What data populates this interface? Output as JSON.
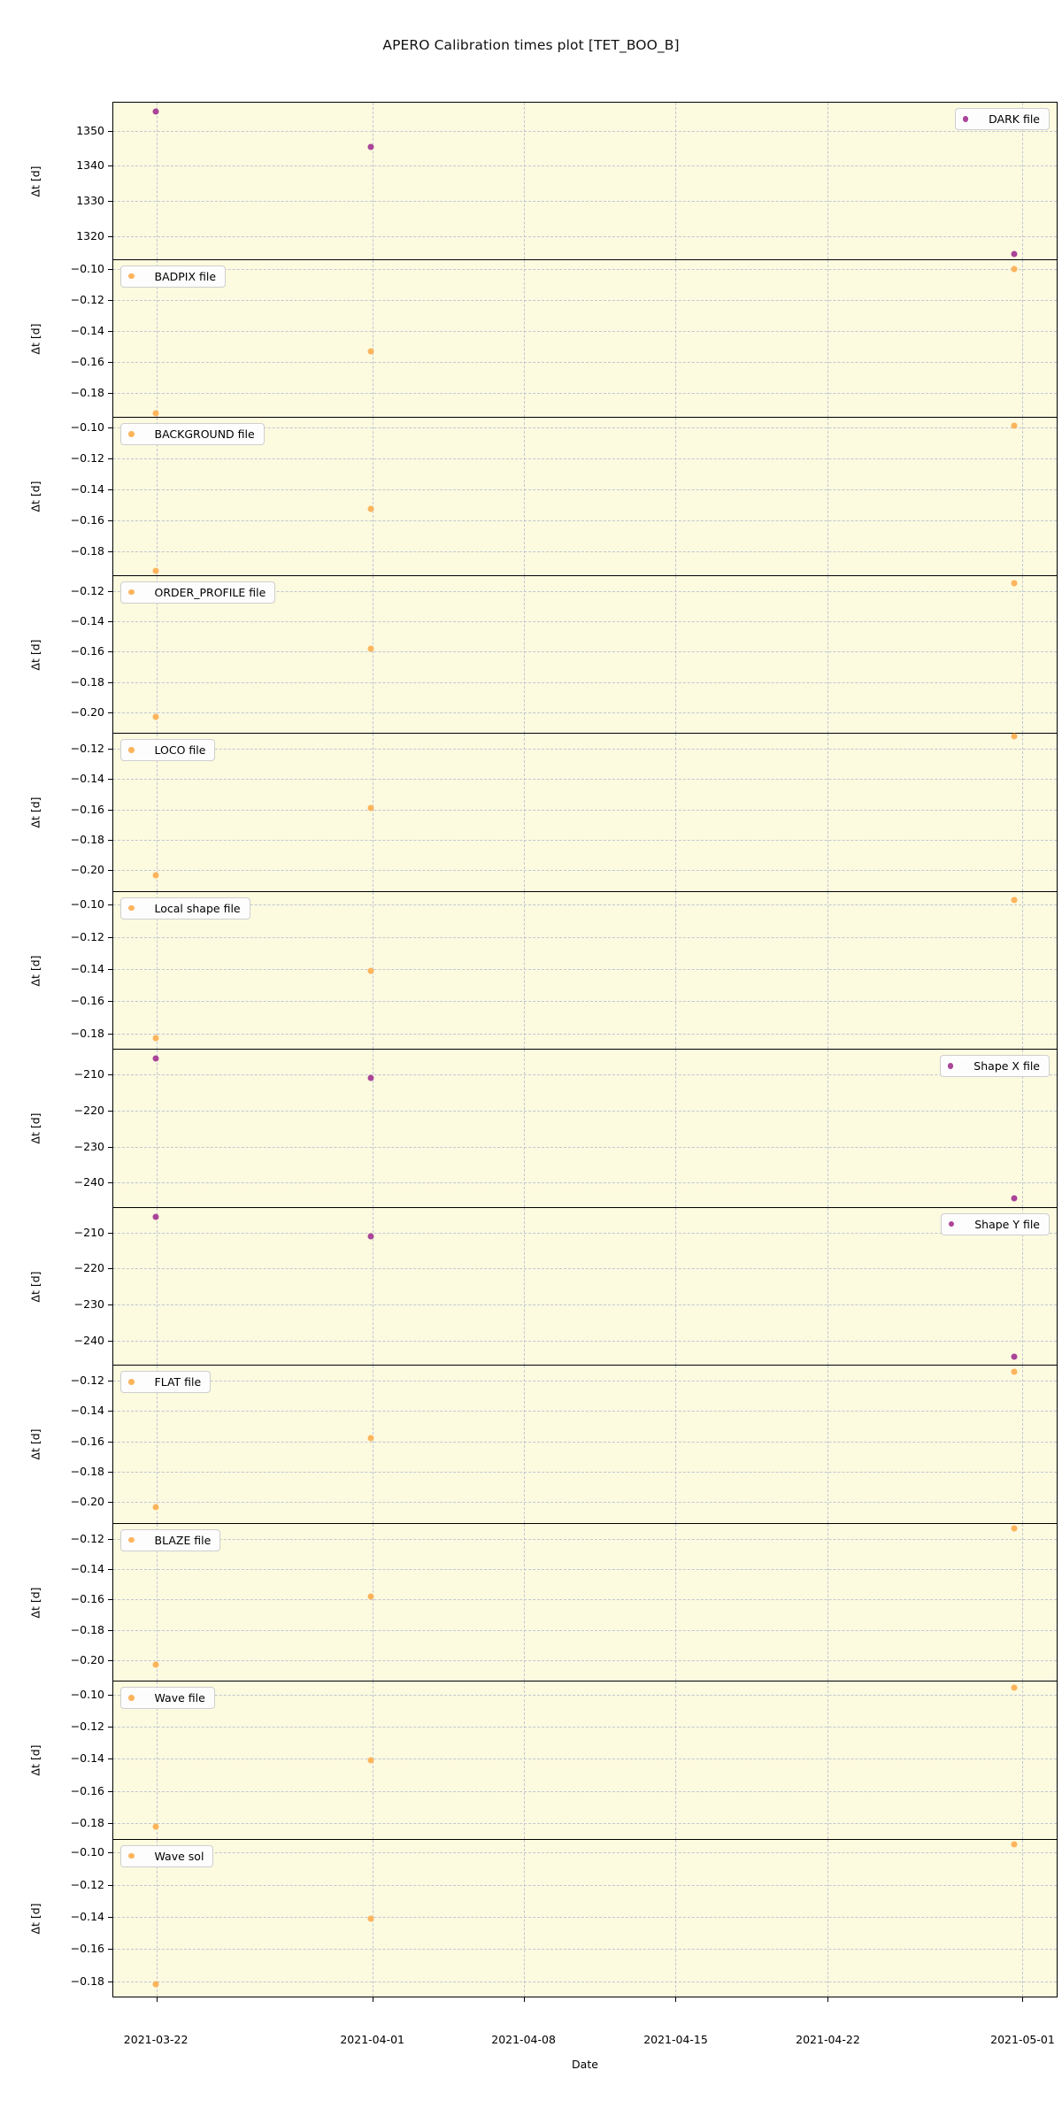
{
  "figure": {
    "title": "APERO Calibration times plot [TET_BOO_B]",
    "xlabel": "Date",
    "ylabel": "Δt [d]",
    "background": "#fcfadf",
    "gridcolor": "#b9bfd0",
    "colors": {
      "orange": "#fdb45c",
      "purple": "#aa4499"
    }
  },
  "xaxis": {
    "ticks": [
      "2021-03-22",
      "2021-04-01",
      "2021-04-08",
      "2021-04-15",
      "2021-04-22",
      "2021-05-01"
    ],
    "tick_positions_pct": [
      4.6,
      27.5,
      43.5,
      59.6,
      75.7,
      96.3
    ],
    "range": [
      "2021-03-20",
      "2021-05-03"
    ]
  },
  "chart_data": {
    "type": "scatter",
    "title": "APERO Calibration times plot [TET_BOO_B]",
    "xlabel": "Date",
    "ylabel": "Δt [d]",
    "grid": true,
    "legend_position": "per-panel",
    "x_tick_labels": [
      "2021-03-22",
      "2021-04-01",
      "2021-04-08",
      "2021-04-15",
      "2021-04-22",
      "2021-05-01"
    ],
    "panels": [
      {
        "name": "DARK file",
        "legend": "DARK file",
        "color": "#aa4499",
        "legend_side": "right",
        "yticks": [
          1320,
          1330,
          1340,
          1350
        ],
        "ylim": [
          1313,
          1358
        ],
        "points": [
          {
            "x": "2021-03-22",
            "y": 1355.5
          },
          {
            "x": "2021-04-01",
            "y": 1345.5
          },
          {
            "x": "2021-05-01",
            "y": 1315.0
          }
        ]
      },
      {
        "name": "BADPIX file",
        "legend": "BADPIX file",
        "color": "#fdb45c",
        "legend_side": "left",
        "yticks": [
          -0.1,
          -0.12,
          -0.14,
          -0.16,
          -0.18
        ],
        "ylim": [
          -0.196,
          -0.094
        ],
        "points": [
          {
            "x": "2021-03-22",
            "y": -0.193
          },
          {
            "x": "2021-04-01",
            "y": -0.153
          },
          {
            "x": "2021-05-01",
            "y": -0.1
          }
        ]
      },
      {
        "name": "BACKGROUND file",
        "legend": "BACKGROUND file",
        "color": "#fdb45c",
        "legend_side": "left",
        "yticks": [
          -0.1,
          -0.12,
          -0.14,
          -0.16,
          -0.18
        ],
        "ylim": [
          -0.196,
          -0.094
        ],
        "points": [
          {
            "x": "2021-03-22",
            "y": -0.193
          },
          {
            "x": "2021-04-01",
            "y": -0.153
          },
          {
            "x": "2021-05-01",
            "y": -0.099
          }
        ]
      },
      {
        "name": "ORDER_PROFILE file",
        "legend": "ORDER_PROFILE file",
        "color": "#fdb45c",
        "legend_side": "left",
        "yticks": [
          -0.12,
          -0.14,
          -0.16,
          -0.18,
          -0.2
        ],
        "ylim": [
          -0.214,
          -0.11
        ],
        "points": [
          {
            "x": "2021-03-22",
            "y": -0.203
          },
          {
            "x": "2021-04-01",
            "y": -0.158
          },
          {
            "x": "2021-05-01",
            "y": -0.115
          }
        ]
      },
      {
        "name": "LOCO file",
        "legend": "LOCO file",
        "color": "#fdb45c",
        "legend_side": "left",
        "yticks": [
          -0.12,
          -0.14,
          -0.16,
          -0.18,
          -0.2
        ],
        "ylim": [
          -0.214,
          -0.11
        ],
        "points": [
          {
            "x": "2021-03-22",
            "y": -0.203
          },
          {
            "x": "2021-04-01",
            "y": -0.159
          },
          {
            "x": "2021-05-01",
            "y": -0.112
          }
        ]
      },
      {
        "name": "Local shape file",
        "legend": "Local shape file",
        "color": "#fdb45c",
        "legend_side": "left",
        "yticks": [
          -0.1,
          -0.12,
          -0.14,
          -0.16,
          -0.18
        ],
        "ylim": [
          -0.19,
          -0.092
        ],
        "points": [
          {
            "x": "2021-03-22",
            "y": -0.183
          },
          {
            "x": "2021-04-01",
            "y": -0.141
          },
          {
            "x": "2021-05-01",
            "y": -0.097
          }
        ]
      },
      {
        "name": "Shape X file",
        "legend": "Shape X file",
        "color": "#aa4499",
        "legend_side": "right",
        "yticks": [
          -210,
          -220,
          -230,
          -240
        ],
        "ylim": [
          -247,
          -203
        ],
        "points": [
          {
            "x": "2021-03-22",
            "y": -205.5
          },
          {
            "x": "2021-04-01",
            "y": -211.0
          },
          {
            "x": "2021-05-01",
            "y": -244.5
          }
        ]
      },
      {
        "name": "Shape Y file",
        "legend": "Shape Y file",
        "color": "#aa4499",
        "legend_side": "right",
        "yticks": [
          -210,
          -220,
          -230,
          -240
        ],
        "ylim": [
          -247,
          -203
        ],
        "points": [
          {
            "x": "2021-03-22",
            "y": -205.5
          },
          {
            "x": "2021-04-01",
            "y": -211.0
          },
          {
            "x": "2021-05-01",
            "y": -244.5
          }
        ]
      },
      {
        "name": "FLAT file",
        "legend": "FLAT file",
        "color": "#fdb45c",
        "legend_side": "left",
        "yticks": [
          -0.12,
          -0.14,
          -0.16,
          -0.18,
          -0.2
        ],
        "ylim": [
          -0.214,
          -0.11
        ],
        "points": [
          {
            "x": "2021-03-22",
            "y": -0.203
          },
          {
            "x": "2021-04-01",
            "y": -0.158
          },
          {
            "x": "2021-05-01",
            "y": -0.114
          }
        ]
      },
      {
        "name": "BLAZE file",
        "legend": "BLAZE file",
        "color": "#fdb45c",
        "legend_side": "left",
        "yticks": [
          -0.12,
          -0.14,
          -0.16,
          -0.18,
          -0.2
        ],
        "ylim": [
          -0.214,
          -0.11
        ],
        "points": [
          {
            "x": "2021-03-22",
            "y": -0.203
          },
          {
            "x": "2021-04-01",
            "y": -0.158
          },
          {
            "x": "2021-05-01",
            "y": -0.113
          }
        ]
      },
      {
        "name": "Wave file",
        "legend": "Wave file",
        "color": "#fdb45c",
        "legend_side": "left",
        "yticks": [
          -0.1,
          -0.12,
          -0.14,
          -0.16,
          -0.18
        ],
        "ylim": [
          -0.19,
          -0.092
        ],
        "points": [
          {
            "x": "2021-03-22",
            "y": -0.182
          },
          {
            "x": "2021-04-01",
            "y": -0.141
          },
          {
            "x": "2021-05-01",
            "y": -0.096
          }
        ]
      },
      {
        "name": "Wave sol",
        "legend": "Wave sol",
        "color": "#fdb45c",
        "legend_side": "left",
        "yticks": [
          -0.1,
          -0.12,
          -0.14,
          -0.16,
          -0.18
        ],
        "ylim": [
          -0.19,
          -0.092
        ],
        "points": [
          {
            "x": "2021-03-22",
            "y": -0.182
          },
          {
            "x": "2021-04-01",
            "y": -0.141
          },
          {
            "x": "2021-05-01",
            "y": -0.095
          }
        ]
      }
    ]
  }
}
